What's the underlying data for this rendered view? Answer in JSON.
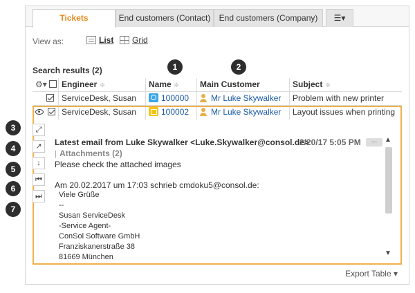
{
  "tabs": [
    {
      "label": "Tickets",
      "active": true
    },
    {
      "label": "End customers (Contact)",
      "active": false
    },
    {
      "label": "End customers (Company)",
      "active": false
    }
  ],
  "tab_more_icon": "☰▾",
  "view_as": {
    "label": "View as:",
    "list": "List",
    "grid": "Grid"
  },
  "search_results": "Search results (2)",
  "callouts": [
    "1",
    "2",
    "3",
    "4",
    "5",
    "6",
    "7"
  ],
  "table": {
    "headers": {
      "engineer": "Engineer",
      "name": "Name",
      "main_customer": "Main Customer",
      "subject": "Subject"
    },
    "sort_glyph": "≑",
    "rows": [
      {
        "engineer": "ServiceDesk, Susan",
        "name": "100000",
        "customer": "Mr Luke Skywalker",
        "subject": "Problem with new printer"
      },
      {
        "engineer": "ServiceDesk, Susan",
        "name": "100002",
        "customer": "Mr Luke Skywalker",
        "subject": "Layout issues when printing"
      }
    ]
  },
  "preview": {
    "header": "Latest email from Luke Skywalker <Luke.Skywalker@consol.de>",
    "date": "2/20/17 5:05 PM",
    "dots": "...",
    "attachments": "Attachments (2)",
    "body": "Please check the attached images",
    "quote_header": "Am 20.02.2017 um 17:03 schrieb cmdoku5@consol.de:",
    "quote_lines": [
      "Viele Grüße",
      "--",
      "Susan ServiceDesk",
      "-Service Agent-",
      "ConSol Software GmbH",
      "Franziskanerstraße 38",
      "81669 München"
    ]
  },
  "export_label": "Export Table ▾",
  "colors": {
    "accent": "#e88a1a",
    "selection_border": "#f0b04a",
    "link": "#1a5aa6"
  }
}
